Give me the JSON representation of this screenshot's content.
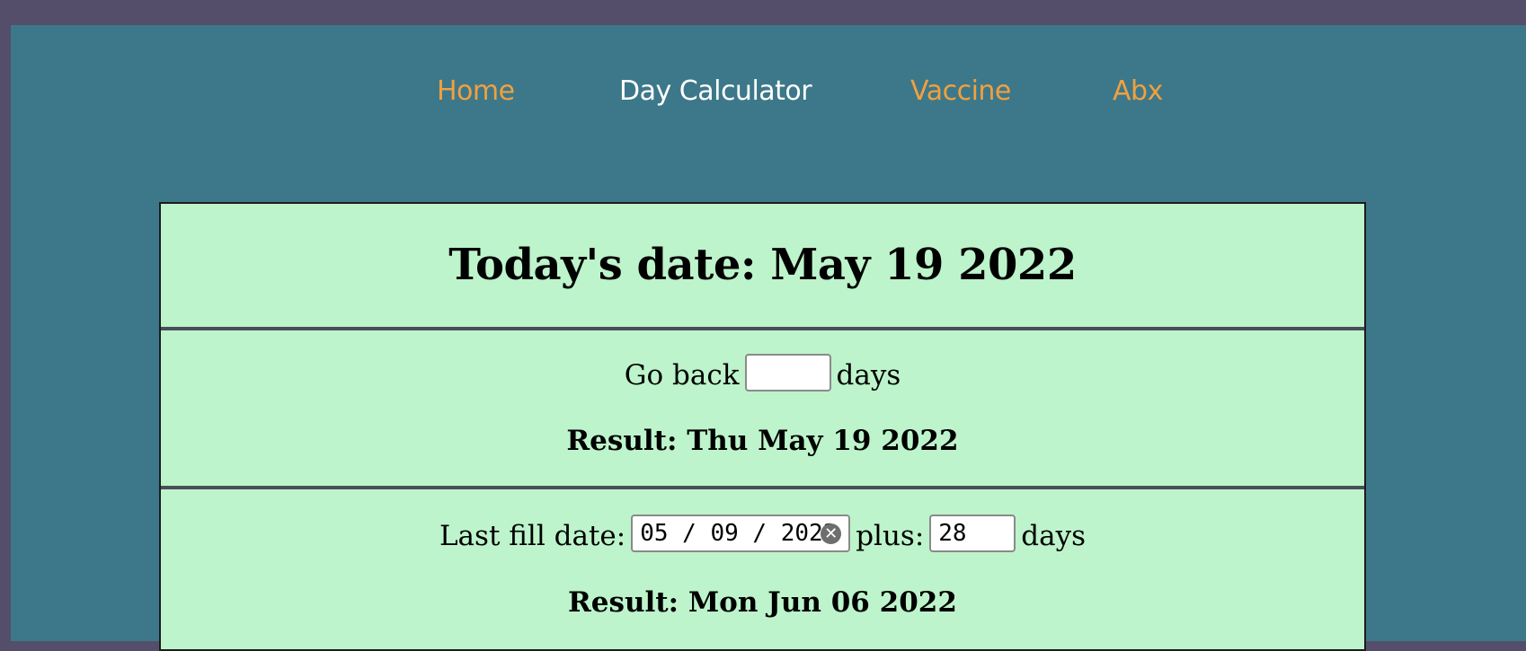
{
  "nav": {
    "items": [
      {
        "label": "Home",
        "active": false
      },
      {
        "label": "Day Calculator",
        "active": true
      },
      {
        "label": "Vaccine",
        "active": false
      },
      {
        "label": "Abx",
        "active": false
      }
    ]
  },
  "header": {
    "title": "Today's date: May 19 2022"
  },
  "go_back": {
    "prefix": "Go back",
    "input_value": "",
    "suffix": "days",
    "result": "Result: Thu May 19 2022"
  },
  "last_fill": {
    "prefix": "Last fill date:",
    "date_value": "05 / 09 / 2022",
    "plus_label": "plus:",
    "days_value": "28",
    "suffix": "days",
    "result": "Result: Mon Jun 06 2022"
  },
  "icons": {
    "clear": "clear-circle-icon"
  },
  "colors": {
    "page_bg": "#554e6a",
    "frame_bg": "#3c7889",
    "nav_link": "#f0a040",
    "nav_active": "#ffffff",
    "card_bg": "#bdf4cb"
  }
}
